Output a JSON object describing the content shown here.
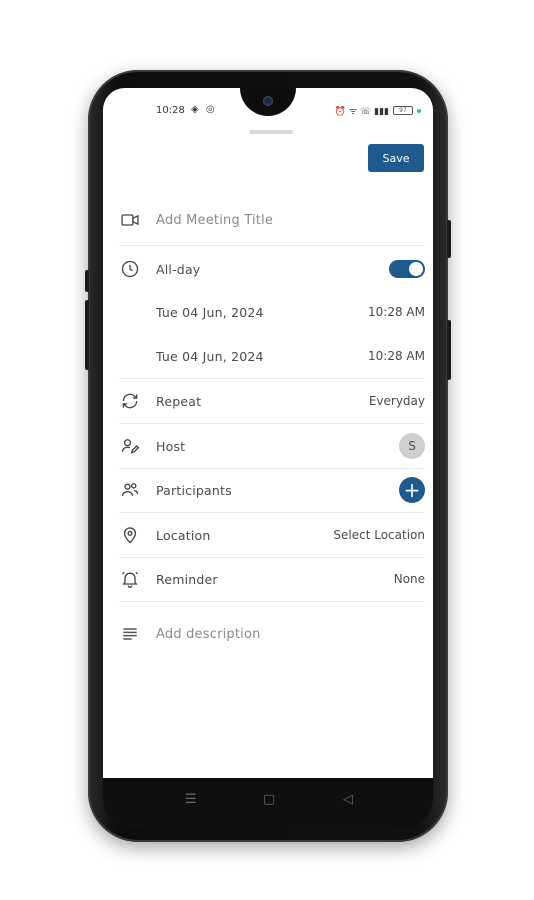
{
  "status": {
    "time": "10:28",
    "left_icons": "◈ ◎",
    "right_icons": "⏰ ᯤ ☏ ▮▮▮",
    "battery": "97"
  },
  "toolbar": {
    "save_label": "Save"
  },
  "form": {
    "title_placeholder": "Add Meeting Title",
    "all_day_label": "All-day",
    "all_day_on": true,
    "start_date": "Tue 04 Jun, 2024",
    "start_time": "10:28 AM",
    "end_date": "Tue 04 Jun, 2024",
    "end_time": "10:28 AM",
    "repeat_label": "Repeat",
    "repeat_value": "Everyday",
    "host_label": "Host",
    "host_initial": "S",
    "participants_label": "Participants",
    "participants_add": "+",
    "location_label": "Location",
    "location_value": "Select Location",
    "reminder_label": "Reminder",
    "reminder_value": "None",
    "description_placeholder": "Add description"
  },
  "nav": {
    "menu": "☰",
    "home": "▢",
    "back": "◁"
  },
  "colors": {
    "accent": "#1f5a8e",
    "avatar_bg": "#cfcfcf",
    "divider": "#ececec"
  },
  "icons": [
    "video-camera-icon",
    "clock-icon",
    "repeat-icon",
    "host-edit-icon",
    "participants-icon",
    "location-pin-icon",
    "reminder-bell-icon",
    "description-lines-icon"
  ]
}
